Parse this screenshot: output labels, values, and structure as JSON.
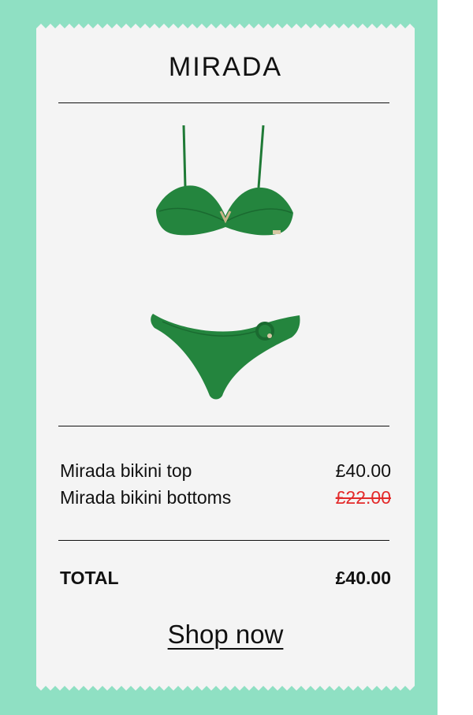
{
  "brand": "MIRADA",
  "product": {
    "image_alt": "green bikini set",
    "color": "#24853e"
  },
  "items": [
    {
      "name": "Mirada bikini top",
      "price": "£40.00",
      "struck": false
    },
    {
      "name": "Mirada bikini bottoms",
      "price": "£22.00",
      "struck": true
    }
  ],
  "total": {
    "label": "TOTAL",
    "value": "£40.00"
  },
  "cta": {
    "label": "Shop now"
  },
  "colors": {
    "frame": "#8fe0c3",
    "receipt": "#f4f4f4",
    "strike_price": "#e32a2a"
  }
}
